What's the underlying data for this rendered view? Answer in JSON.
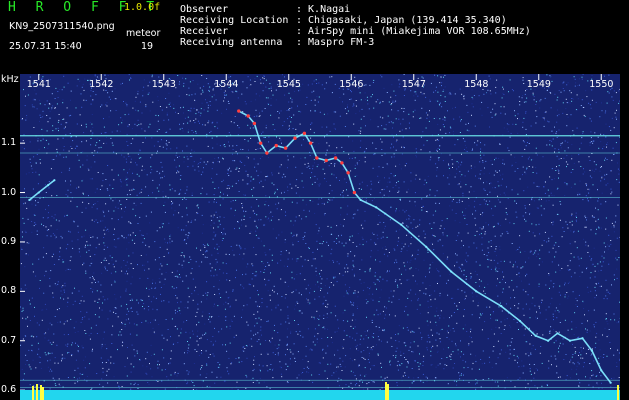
{
  "app": {
    "title": "H R O F F T",
    "version": "1.0.0f"
  },
  "file": {
    "name": "KN9_2507311540.png",
    "datetime": "25.07.31 15:40"
  },
  "meteor": {
    "label": "meteor",
    "count": "19"
  },
  "info": [
    {
      "label": "Observer",
      "value": ": K.Nagai"
    },
    {
      "label": "Receiving Location",
      "value": ": Chigasaki, Japan (139.414 35.340)"
    },
    {
      "label": "Receiver",
      "value": ": AirSpy mini (Miakejima VOR 108.65MHz)"
    },
    {
      "label": "Receiving antenna",
      "value": ": Maspro FM-3"
    }
  ],
  "colors": {
    "background": "#16236e",
    "trace": "#7fe8ff",
    "meteor_head": "#ff4040",
    "reference_line": "#6ff0f0",
    "bottom_band": "#22d6ee"
  },
  "chart_data": {
    "type": "scatter",
    "ylabel": "kHz",
    "xlabel": "",
    "x_ticks": [
      "1541",
      "1542",
      "1543",
      "1544",
      "1545",
      "1546",
      "1547",
      "1548",
      "1549",
      "1550"
    ],
    "y_ticks": [
      "1.1",
      "1.0",
      "0.9",
      "0.8",
      "0.7",
      "0.6"
    ],
    "xlim": [
      1540.7,
      1550.3
    ],
    "ylim": [
      0.58,
      1.24
    ],
    "reference_lines": [
      1.115,
      1.08,
      0.99,
      0.62,
      0.605
    ],
    "series": [
      {
        "points": [
          [
            1540.85,
            0.985
          ],
          [
            1541.0,
            1.0
          ],
          [
            1541.15,
            1.015
          ],
          [
            1541.25,
            1.025
          ]
        ]
      },
      {
        "points": [
          [
            1544.2,
            1.165
          ],
          [
            1544.35,
            1.155
          ],
          [
            1544.45,
            1.14
          ],
          [
            1544.55,
            1.1
          ],
          [
            1544.65,
            1.08
          ],
          [
            1544.8,
            1.095
          ],
          [
            1544.95,
            1.09
          ],
          [
            1545.1,
            1.11
          ],
          [
            1545.25,
            1.12
          ],
          [
            1545.35,
            1.1
          ],
          [
            1545.45,
            1.07
          ],
          [
            1545.6,
            1.065
          ],
          [
            1545.75,
            1.07
          ],
          [
            1545.85,
            1.06
          ],
          [
            1545.95,
            1.04
          ],
          [
            1546.05,
            1.0
          ],
          [
            1546.15,
            0.985
          ],
          [
            1546.4,
            0.97
          ],
          [
            1546.8,
            0.935
          ],
          [
            1547.2,
            0.89
          ],
          [
            1547.6,
            0.84
          ],
          [
            1548.0,
            0.8
          ],
          [
            1548.4,
            0.77
          ],
          [
            1548.7,
            0.74
          ],
          [
            1548.95,
            0.71
          ],
          [
            1549.15,
            0.7
          ],
          [
            1549.3,
            0.715
          ],
          [
            1549.5,
            0.7
          ],
          [
            1549.7,
            0.705
          ],
          [
            1549.85,
            0.68
          ],
          [
            1550.0,
            0.64
          ],
          [
            1550.15,
            0.615
          ]
        ]
      }
    ]
  }
}
